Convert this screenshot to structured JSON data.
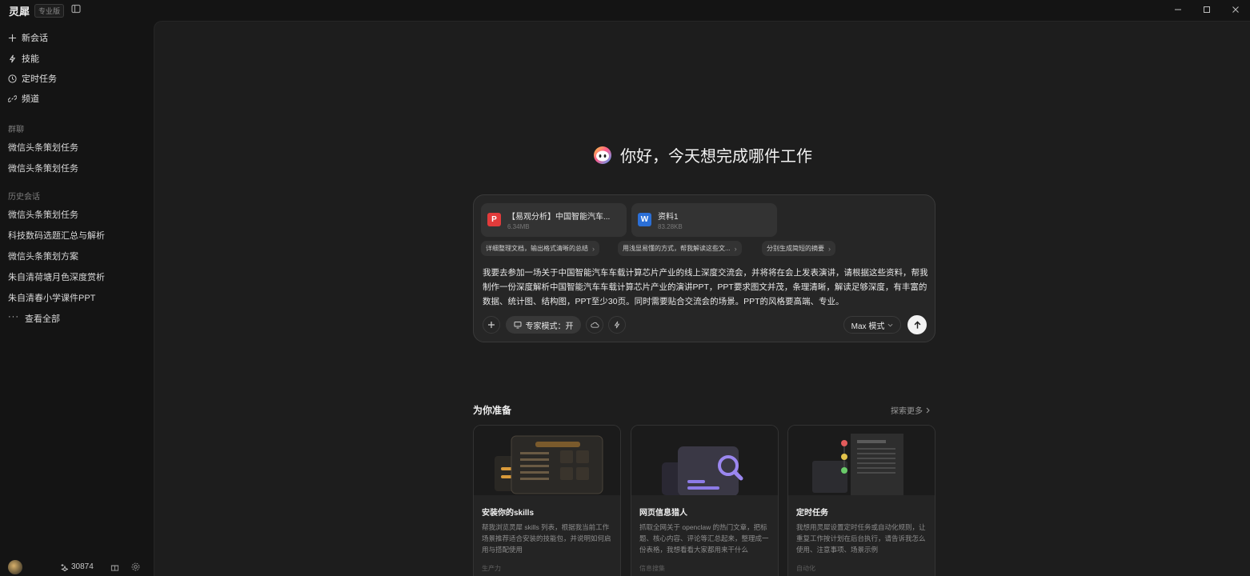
{
  "app": {
    "name": "灵犀",
    "edition": "专业版"
  },
  "sidebar": {
    "nav": [
      {
        "label": "新会话",
        "icon": "plus-icon"
      },
      {
        "label": "技能",
        "icon": "lightning-icon"
      },
      {
        "label": "定时任务",
        "icon": "clock-icon"
      },
      {
        "label": "频道",
        "icon": "link-icon"
      }
    ],
    "groups_label": "群聊",
    "groups": [
      "微信头条策划任务",
      "微信头条策划任务"
    ],
    "history_label": "历史会话",
    "history": [
      "微信头条策划任务",
      "科技数码选题汇总与解析",
      "微信头条策划方案",
      "朱自清荷塘月色深度赏析",
      "朱自清春小学课件PPT"
    ],
    "view_all": "查看全部",
    "points": "30874"
  },
  "main": {
    "greeting": "你好，今天想完成哪件工作",
    "files": [
      {
        "name": "【易观分析】中国智能汽车...",
        "size": "6.34MB",
        "type": "pdf",
        "color": "#e23b3b"
      },
      {
        "name": "资料1",
        "size": "83.28KB",
        "type": "word",
        "color": "#2b6fd6"
      }
    ],
    "suggestions": [
      "详细整理文档，输出格式清晰的总结",
      "用浅显易懂的方式，帮我解读这些文...",
      "分别生成简短的摘要"
    ],
    "prompt": "我要去参加一场关于中国智能汽车车载计算芯片产业的线上深度交流会，并将将在会上发表演讲，请根据这些资料，帮我制作一份深度解析中国智能汽车车载计算芯片产业的演讲PPT，PPT要求图文并茂，条理清晰，解读足够深度，有丰富的数据、统计图、结构图，PPT至少30页。同时需要贴合交流会的场景。PPT的风格要高端、专业。",
    "expert_mode": "专家模式：开",
    "max_mode": "Max 模式",
    "section_title": "为你准备",
    "explore_more": "探索更多",
    "cards": [
      {
        "title": "安装你的skills",
        "desc": "帮我浏览灵犀 skills 列表，根据我当前工作场景推荐适合安装的技能包，并说明如何启用与搭配使用",
        "tag": "生产力"
      },
      {
        "title": "网页信息猎人",
        "desc": "抓取全网关于 openclaw 的热门文章，把标题、核心内容、评论等汇总起来，整理成一份表格，我想看看大家都用来干什么",
        "tag": "信息搜集"
      },
      {
        "title": "定时任务",
        "desc": "我想用灵犀设置定时任务或自动化规则，让重复工作按计划在后台执行，请告诉我怎么使用、注意事项、场景示例",
        "tag": "自动化"
      }
    ]
  }
}
